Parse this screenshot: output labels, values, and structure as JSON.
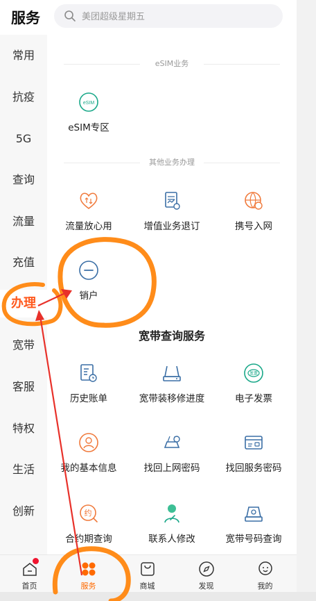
{
  "header": {
    "title": "服务",
    "search_placeholder": "美团超级星期五"
  },
  "sidebar": {
    "items": [
      {
        "label": "常用"
      },
      {
        "label": "抗疫"
      },
      {
        "label": "5G"
      },
      {
        "label": "查询"
      },
      {
        "label": "流量"
      },
      {
        "label": "充值"
      },
      {
        "label": "办理",
        "active": true
      },
      {
        "label": "宽带"
      },
      {
        "label": "客服"
      },
      {
        "label": "特权"
      },
      {
        "label": "生活"
      },
      {
        "label": "创新"
      }
    ]
  },
  "content": {
    "esim_section": {
      "title": "eSIM业务",
      "items": [
        {
          "label": "eSIM专区",
          "icon": "esim-icon",
          "icon_text": "eSIM"
        }
      ]
    },
    "other_section": {
      "title": "其他业务办理",
      "items": [
        {
          "label": "流量放心用",
          "icon": "heart-data-icon"
        },
        {
          "label": "增值业务退订",
          "icon": "document-chart-icon"
        },
        {
          "label": "携号入网",
          "icon": "globe-transfer-icon"
        },
        {
          "label": "销户",
          "icon": "minus-circle-icon"
        }
      ]
    },
    "broadband_section": {
      "title": "宽带查询服务",
      "items": [
        {
          "label": "历史账单",
          "icon": "bill-history-icon"
        },
        {
          "label": "宽带装移修进度",
          "icon": "router-progress-icon"
        },
        {
          "label": "电子发票",
          "icon": "e-invoice-icon",
          "icon_text": "发票"
        },
        {
          "label": "我的基本信息",
          "icon": "user-info-icon"
        },
        {
          "label": "找回上网密码",
          "icon": "router-key-icon"
        },
        {
          "label": "找回服务密码",
          "icon": "password-card-icon"
        },
        {
          "label": "合约期查询",
          "icon": "contract-icon",
          "icon_text": "约"
        },
        {
          "label": "联系人修改",
          "icon": "contact-edit-icon"
        },
        {
          "label": "宽带号码查询",
          "icon": "router-lookup-icon"
        }
      ]
    }
  },
  "tabbar": {
    "items": [
      {
        "label": "首页",
        "icon": "home-icon",
        "badge": true
      },
      {
        "label": "服务",
        "icon": "services-grid-icon",
        "active": true
      },
      {
        "label": "商城",
        "icon": "shopping-bag-icon"
      },
      {
        "label": "发现",
        "icon": "compass-icon"
      },
      {
        "label": "我的",
        "icon": "profile-icon"
      }
    ]
  },
  "colors": {
    "accent": "#ff5a1f",
    "annotation_orange": "#ff8c1a",
    "annotation_arrow": "#e8312a",
    "icon_blue": "#3a6ea5",
    "icon_teal": "#1aa889",
    "icon_orange": "#f07a3c"
  }
}
